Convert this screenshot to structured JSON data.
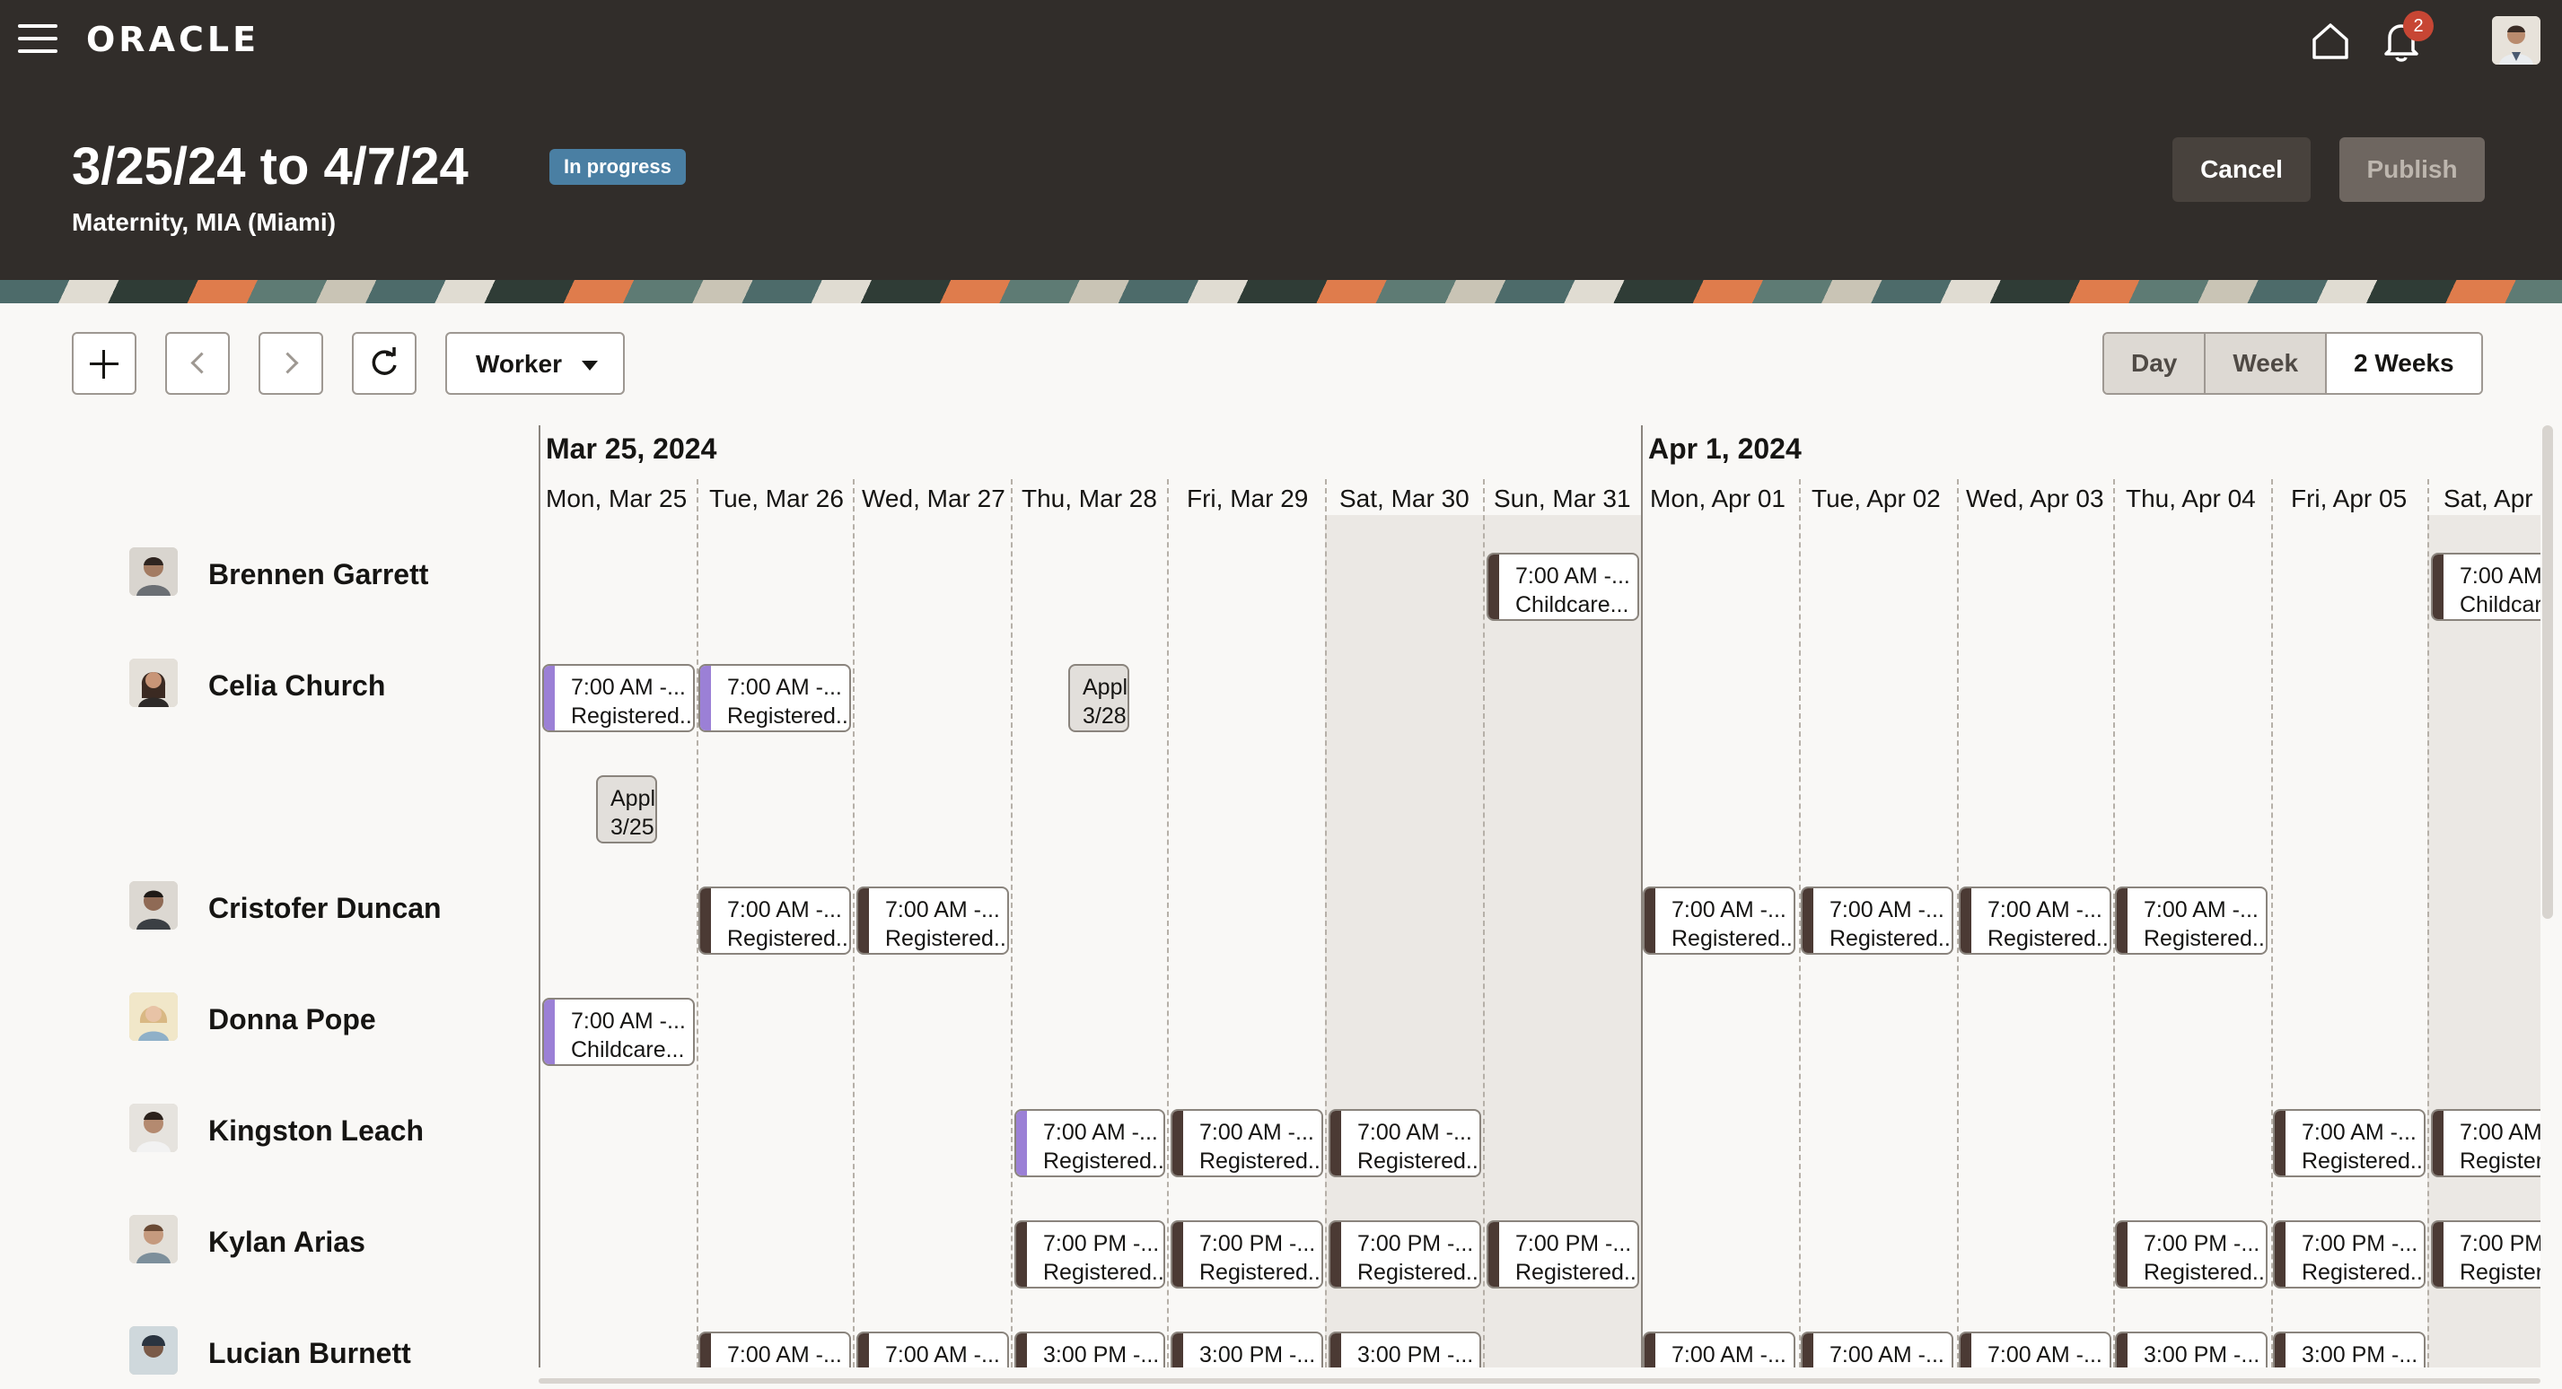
{
  "header": {
    "logo": "ORACLE",
    "notification_count": "2"
  },
  "page": {
    "title": "3/25/24 to 4/7/24",
    "status": "In progress",
    "subtitle": "Maternity, MIA (Miami)",
    "cancel_label": "Cancel",
    "publish_label": "Publish"
  },
  "toolbar": {
    "group_by": "Worker",
    "views": [
      "Day",
      "Week",
      "2 Weeks"
    ]
  },
  "calendar": {
    "weeks": [
      "Mar 25, 2024",
      "Apr 1, 2024"
    ],
    "days": [
      "Mon, Mar 25",
      "Tue, Mar 26",
      "Wed, Mar 27",
      "Thu, Mar 28",
      "Fri, Mar 29",
      "Sat, Mar 30",
      "Sun, Mar 31",
      "Mon, Apr 01",
      "Tue, Apr 02",
      "Wed, Apr 03",
      "Thu, Apr 04",
      "Fri, Apr 05",
      "Sat, Apr"
    ]
  },
  "workers": [
    {
      "name": "Brennen Garrett"
    },
    {
      "name": "Celia Church"
    },
    {
      "name": "Cristofer Duncan"
    },
    {
      "name": "Donna Pope"
    },
    {
      "name": "Kingston Leach"
    },
    {
      "name": "Kylan Arias"
    },
    {
      "name": "Lucian Burnett"
    }
  ],
  "shifts": {
    "brennen": [
      {
        "l1": "7:00 AM -...",
        "l2": "Childcare..."
      },
      {
        "l1": "7:00 AM",
        "l2": "Childcar"
      }
    ],
    "celia": [
      {
        "l1": "7:00 AM -...",
        "l2": "Registered..."
      },
      {
        "l1": "7:00 AM -...",
        "l2": "Registered..."
      },
      {
        "l1": "Appl",
        "l2": "3/28"
      },
      {
        "l1": "Appl",
        "l2": "3/25"
      }
    ],
    "cristofer": [
      {
        "l1": "7:00 AM -...",
        "l2": "Registered..."
      },
      {
        "l1": "7:00 AM -...",
        "l2": "Registered..."
      },
      {
        "l1": "7:00 AM -...",
        "l2": "Registered..."
      },
      {
        "l1": "7:00 AM -...",
        "l2": "Registered..."
      },
      {
        "l1": "7:00 AM -...",
        "l2": "Registered..."
      },
      {
        "l1": "7:00 AM -...",
        "l2": "Registered..."
      }
    ],
    "donna": [
      {
        "l1": "7:00 AM -...",
        "l2": "Childcare..."
      }
    ],
    "kingston": [
      {
        "l1": "7:00 AM -...",
        "l2": "Registered..."
      },
      {
        "l1": "7:00 AM -...",
        "l2": "Registered..."
      },
      {
        "l1": "7:00 AM -...",
        "l2": "Registered..."
      },
      {
        "l1": "7:00 AM -...",
        "l2": "Registered..."
      },
      {
        "l1": "7:00 AM",
        "l2": "Register"
      }
    ],
    "kylan": [
      {
        "l1": "7:00 PM -...",
        "l2": "Registered..."
      },
      {
        "l1": "7:00 PM -...",
        "l2": "Registered..."
      },
      {
        "l1": "7:00 PM -...",
        "l2": "Registered..."
      },
      {
        "l1": "7:00 PM -...",
        "l2": "Registered..."
      },
      {
        "l1": "7:00 PM -...",
        "l2": "Registered..."
      },
      {
        "l1": "7:00 PM -...",
        "l2": "Registered..."
      },
      {
        "l1": "7:00 PM",
        "l2": "Register"
      }
    ],
    "lucian": [
      {
        "l1": "7:00 AM -..."
      },
      {
        "l1": "7:00 AM -..."
      },
      {
        "l1": "3:00 PM -..."
      },
      {
        "l1": "3:00 PM -..."
      },
      {
        "l1": "3:00 PM -..."
      },
      {
        "l1": "7:00 AM -..."
      },
      {
        "l1": "7:00 AM -..."
      },
      {
        "l1": "7:00 AM -..."
      },
      {
        "l1": "3:00 PM -..."
      },
      {
        "l1": "3:00 PM -..."
      }
    ]
  }
}
